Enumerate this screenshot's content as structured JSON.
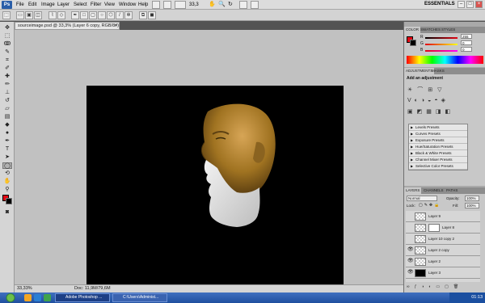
{
  "menu": {
    "logo": "Ps",
    "items": [
      "File",
      "Edit",
      "Image",
      "Layer",
      "Select",
      "Filter",
      "View",
      "Window",
      "Help"
    ],
    "zoom": "33,3",
    "workspace": "ESSENTIALS",
    "win_min": "–",
    "win_max": "□",
    "win_close": "×"
  },
  "document": {
    "tab_title": "sourceimage.psd @ 33,3% (Layer 6 copy, RGB/8#) *",
    "tab_close": "×",
    "zoom_status": "33,33%",
    "doc_info": "Doc: 11,9M/79,6M"
  },
  "colors": {
    "fg": "#e30613",
    "bg": "#000000",
    "canvas": "#000000",
    "workspace": "#c1c1c1"
  },
  "color_panel": {
    "tabs": [
      "COLOR",
      "SWATCHES",
      "STYLES"
    ],
    "channels": [
      {
        "label": "R",
        "value": "255"
      },
      {
        "label": "G",
        "value": "0"
      },
      {
        "label": "B",
        "value": "0"
      }
    ]
  },
  "adjustments_panel": {
    "tabs": [
      "ADJUSTMENTS",
      "MASKS"
    ],
    "heading": "Add an adjustment",
    "presets": [
      "Levels Presets",
      "Curves Presets",
      "Exposure Presets",
      "Hue/Saturation Presets",
      "Black & White Presets",
      "Channel Mixer Presets",
      "Selective Color Presets"
    ]
  },
  "layers_panel": {
    "tabs": [
      "LAYERS",
      "CHANNELS",
      "PATHS"
    ],
    "blend_mode": "Normal",
    "opacity_label": "Opacity:",
    "opacity": "100%",
    "lock_label": "Lock:",
    "fill_label": "Fill:",
    "fill": "100%",
    "layers": [
      {
        "name": "Layer 9",
        "visible": false,
        "mask": false
      },
      {
        "name": "Layer 8",
        "visible": false,
        "mask": true
      },
      {
        "name": "Layer 10 copy 2",
        "visible": false,
        "mask": false
      },
      {
        "name": "Layer 2 copy",
        "visible": true,
        "mask": false
      },
      {
        "name": "Layer 2",
        "visible": true,
        "mask": false
      },
      {
        "name": "Layer 3",
        "visible": true,
        "mask": false
      }
    ]
  },
  "taskbar": {
    "tasks": [
      "Adobe Photoshop ...",
      "C:\\Users\\Administ..."
    ],
    "clock": "01:13"
  }
}
